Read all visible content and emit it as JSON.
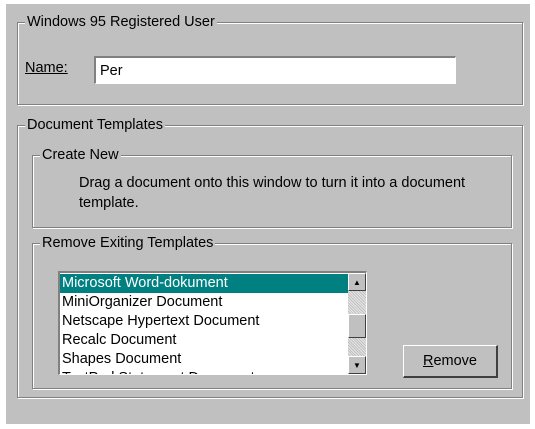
{
  "user_group": {
    "legend": "Windows 95 Registered User",
    "name_label": "Name:",
    "name_value": "Per"
  },
  "templates_group": {
    "legend": "Document Templates",
    "create_new": {
      "legend": "Create New",
      "text": "Drag a document onto this window to turn it into a document template."
    },
    "remove_existing": {
      "legend": "Remove Exiting Templates",
      "items": [
        "Microsoft Word-dokument",
        "MiniOrganizer Document",
        "Netscape Hypertext Document",
        "Recalc Document",
        "Shapes Document",
        "TextPad Statement Document"
      ],
      "selected_index": 0,
      "remove_button": "Remove"
    }
  },
  "colors": {
    "face": "#c0c0c0",
    "selection": "#008080",
    "shadow": "#808080"
  },
  "icons": {
    "scroll_up": "triangle-up",
    "scroll_down": "triangle-down"
  }
}
